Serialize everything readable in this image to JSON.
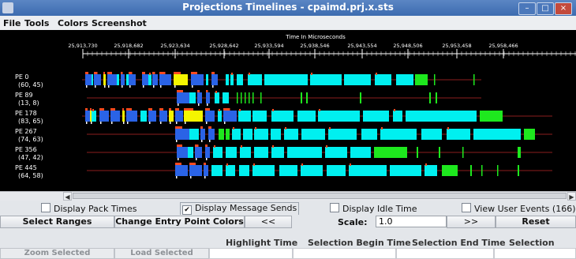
{
  "window": {
    "title": "Projections Timelines - cpaimd.prj.x.sts",
    "min_label": "–",
    "max_label": "□",
    "close_label": "×"
  },
  "menu": [
    "File",
    "Tools",
    "Colors",
    "Screenshot"
  ],
  "axis": {
    "title": "Time In Microseconds",
    "ticks": [
      "25,913,730",
      "25,918,682",
      "25,923,634",
      "25,928,642",
      "25,933,594",
      "25,938,546",
      "25,943,554",
      "25,948,506",
      "25,953,458",
      "25,958,466"
    ]
  },
  "pes": [
    {
      "name": "PE 0",
      "stats": "(60, 45)"
    },
    {
      "name": "PE 89",
      "stats": "(13, 8)"
    },
    {
      "name": "PE 178",
      "stats": "(83, 65)"
    },
    {
      "name": "PE 267",
      "stats": "(74, 63)"
    },
    {
      "name": "PE 356",
      "stats": "(47, 42)"
    },
    {
      "name": "PE 445",
      "stats": "(64, 58)"
    }
  ],
  "colors": {
    "canvas_bg": "#000000",
    "cyan": "#00f0f0",
    "blue": "#2a63e6",
    "yellow": "#f5f500",
    "green": "#1ee81e",
    "orange_red": "#ff4a1e",
    "white": "#ffffff",
    "line": "#8c1e1e"
  },
  "controls": {
    "display_pack_times": "Display Pack Times",
    "display_message_sends": "Display Message Sends",
    "display_idle_time": "Display Idle Time",
    "view_user_events": "View User Events (166)",
    "select_ranges": "Select Ranges",
    "change_entry_point_colors": "Change Entry Point Colors",
    "prev": "<<",
    "scale_label": "Scale:",
    "scale_value": "1.0",
    "next": ">>",
    "reset": "Reset"
  },
  "info_headers": {
    "highlight_time": "Highlight Time",
    "selection_begin_time": "Selection Begin Time",
    "selection_end_time": "Selection End Time",
    "selection_length": "Selection Length"
  },
  "bottom": {
    "zoom_selected": "Zoom Selected",
    "load_selected": "Load Selected"
  }
}
